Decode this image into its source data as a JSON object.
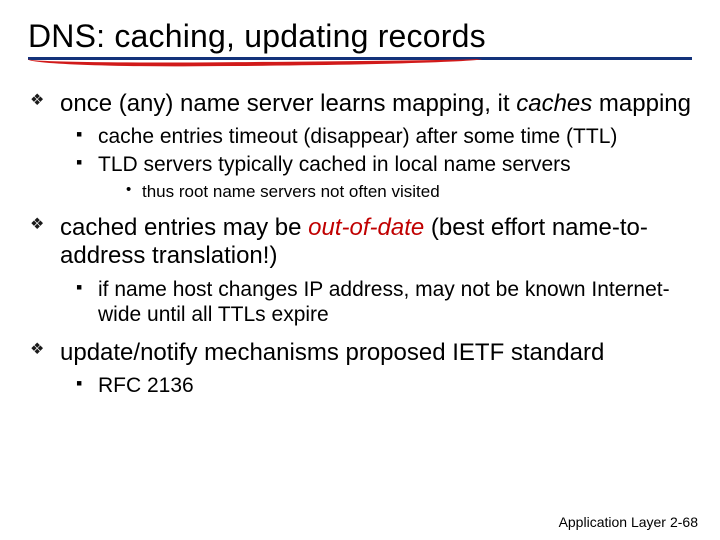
{
  "title": "DNS: caching, updating records",
  "bullets": [
    {
      "prefix": "once (any) name server learns mapping, it ",
      "em_word": "caches",
      "suffix": " mapping",
      "sub": [
        {
          "text": "cache entries timeout (disappear) after some time (TTL)"
        },
        {
          "text": "TLD servers typically cached in local name servers",
          "subsub": [
            {
              "text": "thus root name servers not often visited"
            }
          ]
        }
      ]
    },
    {
      "prefix": "cached entries may be ",
      "red_em": "out-of-date",
      "suffix": " (best effort name-to-address translation!)",
      "sub": [
        {
          "text": "if name host changes IP address, may not be known Internet-wide until all TTLs expire"
        }
      ]
    },
    {
      "prefix": "update/notify mechanisms proposed IETF standard",
      "sub": [
        {
          "text": "RFC 2136"
        }
      ]
    }
  ],
  "footer": {
    "label": "Application Layer",
    "page": "2-68"
  }
}
